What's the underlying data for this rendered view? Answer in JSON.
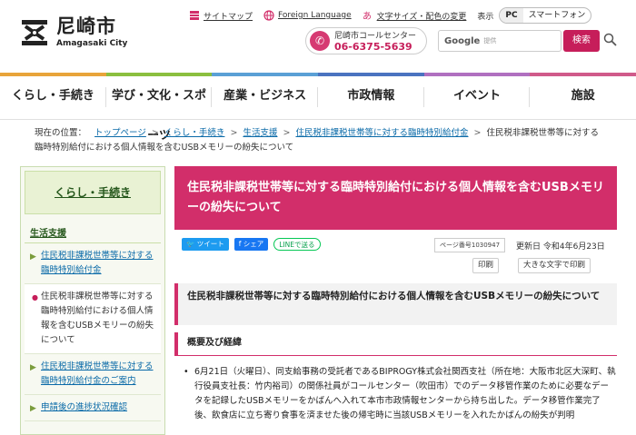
{
  "header": {
    "logo_jp": "尼崎市",
    "logo_en": "Amagasaki City",
    "utility": {
      "sitemap": "サイトマップ",
      "foreign": "Foreign Language",
      "textsize": "文字サイズ・配色の変更",
      "display_label": "表示",
      "pc": "PC",
      "smartphone": "スマートフォン"
    },
    "callcenter": {
      "label": "尼崎市コールセンター",
      "number": "06-6375-5639"
    },
    "search": {
      "provider": "Google",
      "placeholder": "提供",
      "button": "検索"
    }
  },
  "gnav": {
    "items": [
      "くらし・手続き",
      "学び・文化・スポーツ",
      "産業・ビジネス",
      "市政情報",
      "イベント",
      "施設"
    ],
    "colors": [
      "#e8a43a",
      "#8bbf3f",
      "#5aa0d6",
      "#4a73c0",
      "#b070c0",
      "#d05a8a"
    ]
  },
  "breadcrumb": {
    "prefix": "現在の位置：",
    "links": [
      "トップページ",
      "くらし・手続き",
      "生活支援",
      "住民税非課税世帯等に対する臨時特別給付金"
    ],
    "current": "住民税非課税世帯等に対する臨時特別給付における個人情報を含むUSBメモリーの紛失について"
  },
  "sidebar": {
    "heading": "くらし・手続き",
    "subheading": "生活支援",
    "items": [
      {
        "label": "住民税非課税世帯等に対する臨時特別給付金",
        "type": "link"
      },
      {
        "label": "住民税非課税世帯等に対する臨時特別給付における個人情報を含むUSBメモリーの紛失について",
        "type": "current"
      },
      {
        "label": "住民税非課税世帯等に対する臨時特別給付金のご案内",
        "type": "link"
      },
      {
        "label": "申請後の進捗状況確認",
        "type": "link"
      }
    ]
  },
  "main": {
    "title": "住民税非課税世帯等に対する臨時特別給付における個人情報を含むUSBメモリーの紛失について",
    "share": {
      "tweet": "ツイート",
      "facebook": "シェア",
      "line": "LINEで送る"
    },
    "page_number": "ページ番号1030947",
    "updated": "更新日 令和4年6月23日",
    "print": "印刷",
    "print_large": "大きな文字で印刷",
    "h2": "住民税非課税世帯等に対する臨時特別給付における個人情報を含むUSBメモリーの紛失について",
    "h3": "概要及び経緯",
    "paragraph": "6月21日（火曜日）、同支給事務の受託者であるBIPROGY株式会社関西支社（所在地：大阪市北区大深町、執行役員支社長：竹内裕司）の関係社員がコールセンター（吹田市）でのデータ移管作業のために必要なデータを記録したUSBメモリーをかばんへ入れて本市市政情報センターから持ち出した。データ移管作業完了後、飲食店に立ち寄り食事を済ませた後の帰宅時に当該USBメモリーを入れたかばんの紛失が判明"
  },
  "colors": {
    "accent": "#d22e6a",
    "link": "#0a6aa8",
    "sidebar_green": "#24561a"
  }
}
